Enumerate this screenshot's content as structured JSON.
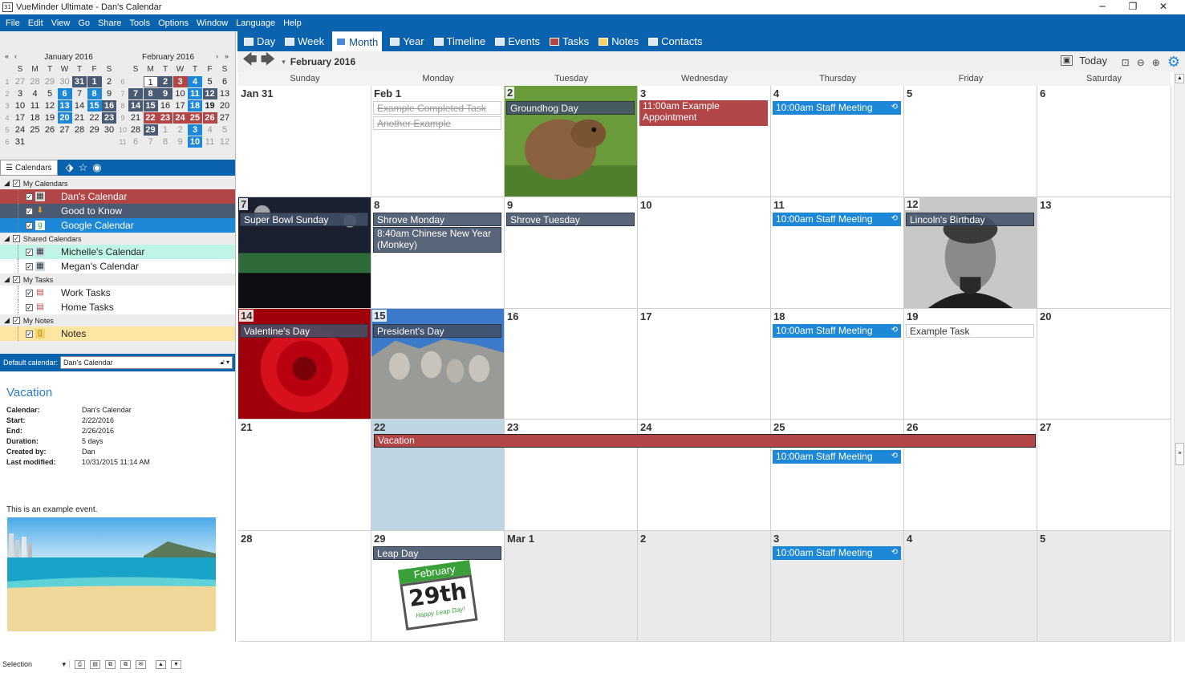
{
  "titlebar": {
    "app_icon": "31",
    "title": "VueMinder Ultimate - Dan's Calendar",
    "minimize": "─",
    "restore": "❐",
    "close": "✕"
  },
  "menu": [
    "File",
    "Edit",
    "View",
    "Go",
    "Share",
    "Tools",
    "Options",
    "Window",
    "Language",
    "Help"
  ],
  "minical": {
    "jan": {
      "title": "January 2016",
      "days": [
        "S",
        "M",
        "T",
        "W",
        "T",
        "F",
        "S"
      ],
      "weeks": [
        {
          "wk": "1",
          "cells": [
            {
              "t": "27",
              "c": "o"
            },
            {
              "t": "28",
              "c": "o"
            },
            {
              "t": "29",
              "c": "o"
            },
            {
              "t": "30",
              "c": "o"
            },
            {
              "t": "31",
              "c": "d"
            },
            {
              "t": "1",
              "c": "d"
            },
            {
              "t": "2",
              "c": ""
            }
          ]
        },
        {
          "wk": "2",
          "cells": [
            {
              "t": "3",
              "c": ""
            },
            {
              "t": "4",
              "c": ""
            },
            {
              "t": "5",
              "c": ""
            },
            {
              "t": "6",
              "c": "b"
            },
            {
              "t": "7",
              "c": ""
            },
            {
              "t": "8",
              "c": "b"
            },
            {
              "t": "9",
              "c": ""
            }
          ]
        },
        {
          "wk": "3",
          "cells": [
            {
              "t": "10",
              "c": ""
            },
            {
              "t": "11",
              "c": ""
            },
            {
              "t": "12",
              "c": ""
            },
            {
              "t": "13",
              "c": "b"
            },
            {
              "t": "14",
              "c": ""
            },
            {
              "t": "15",
              "c": "b"
            },
            {
              "t": "16",
              "c": "d"
            }
          ]
        },
        {
          "wk": "4",
          "cells": [
            {
              "t": "17",
              "c": ""
            },
            {
              "t": "18",
              "c": ""
            },
            {
              "t": "19",
              "c": ""
            },
            {
              "t": "20",
              "c": "b"
            },
            {
              "t": "21",
              "c": ""
            },
            {
              "t": "22",
              "c": ""
            },
            {
              "t": "23",
              "c": "d"
            }
          ]
        },
        {
          "wk": "5",
          "cells": [
            {
              "t": "24",
              "c": ""
            },
            {
              "t": "25",
              "c": ""
            },
            {
              "t": "26",
              "c": ""
            },
            {
              "t": "27",
              "c": ""
            },
            {
              "t": "28",
              "c": ""
            },
            {
              "t": "29",
              "c": ""
            },
            {
              "t": "30",
              "c": ""
            }
          ]
        },
        {
          "wk": "6",
          "cells": [
            {
              "t": "31",
              "c": ""
            },
            {
              "t": "",
              "c": ""
            },
            {
              "t": "",
              "c": ""
            },
            {
              "t": "",
              "c": ""
            },
            {
              "t": "",
              "c": ""
            },
            {
              "t": "",
              "c": ""
            },
            {
              "t": "",
              "c": ""
            }
          ]
        }
      ]
    },
    "feb": {
      "title": "February 2016",
      "days": [
        "S",
        "M",
        "T",
        "W",
        "T",
        "F",
        "S"
      ],
      "weeks": [
        {
          "wk": "6",
          "cells": [
            {
              "t": "",
              "c": ""
            },
            {
              "t": "1",
              "c": "w"
            },
            {
              "t": "2",
              "c": "d"
            },
            {
              "t": "3",
              "c": "r"
            },
            {
              "t": "4",
              "c": "b"
            },
            {
              "t": "5",
              "c": ""
            },
            {
              "t": "6",
              "c": ""
            }
          ]
        },
        {
          "wk": "7",
          "cells": [
            {
              "t": "7",
              "c": "d"
            },
            {
              "t": "8",
              "c": "d"
            },
            {
              "t": "9",
              "c": "d"
            },
            {
              "t": "10",
              "c": ""
            },
            {
              "t": "11",
              "c": "b"
            },
            {
              "t": "12",
              "c": "d"
            },
            {
              "t": "13",
              "c": ""
            }
          ]
        },
        {
          "wk": "8",
          "cells": [
            {
              "t": "14",
              "c": "d"
            },
            {
              "t": "15",
              "c": "d"
            },
            {
              "t": "16",
              "c": ""
            },
            {
              "t": "17",
              "c": ""
            },
            {
              "t": "18",
              "c": "b"
            },
            {
              "t": "19",
              "c": "bd"
            },
            {
              "t": "20",
              "c": ""
            }
          ]
        },
        {
          "wk": "9",
          "cells": [
            {
              "t": "21",
              "c": ""
            },
            {
              "t": "22",
              "c": "r"
            },
            {
              "t": "23",
              "c": "r"
            },
            {
              "t": "24",
              "c": "r"
            },
            {
              "t": "25",
              "c": "r"
            },
            {
              "t": "26",
              "c": "r"
            },
            {
              "t": "27",
              "c": ""
            }
          ]
        },
        {
          "wk": "10",
          "cells": [
            {
              "t": "28",
              "c": ""
            },
            {
              "t": "29",
              "c": "d"
            },
            {
              "t": "1",
              "c": "o"
            },
            {
              "t": "2",
              "c": "o"
            },
            {
              "t": "3",
              "c": "b"
            },
            {
              "t": "4",
              "c": "o"
            },
            {
              "t": "5",
              "c": "o"
            }
          ]
        },
        {
          "wk": "11",
          "cells": [
            {
              "t": "6",
              "c": "o"
            },
            {
              "t": "7",
              "c": "o"
            },
            {
              "t": "8",
              "c": "o"
            },
            {
              "t": "9",
              "c": "o"
            },
            {
              "t": "10",
              "c": "b"
            },
            {
              "t": "11",
              "c": "o"
            },
            {
              "t": "12",
              "c": "o"
            }
          ]
        }
      ]
    }
  },
  "cal_tabs": {
    "calendars": "Calendars"
  },
  "cal_list": {
    "my_calendars": "My Calendars",
    "dans": "Dan's Calendar",
    "good": "Good to Know",
    "google": "Google Calendar",
    "shared": "Shared Calendars",
    "michelle": "Michelle's Calendar",
    "megan": "Megan's Calendar",
    "my_tasks": "My Tasks",
    "work": "Work Tasks",
    "home": "Home Tasks",
    "my_notes": "My Notes",
    "notes": "Notes"
  },
  "default_calendar": {
    "label": "Default calendar:",
    "value": "Dan's Calendar"
  },
  "details": {
    "title": "Vacation",
    "calendar_label": "Calendar:",
    "calendar": "Dan's Calendar",
    "start_label": "Start:",
    "start": "2/22/2016",
    "end_label": "End:",
    "end": "2/26/2016",
    "duration_label": "Duration:",
    "duration": "5 days",
    "created_label": "Created by:",
    "created": "Dan",
    "modified_label": "Last modified:",
    "modified": "10/31/2015 11:14 AM",
    "description": "This is an example event."
  },
  "status": {
    "selection": "Selection"
  },
  "views": {
    "day": "Day",
    "week": "Week",
    "month": "Month",
    "year": "Year",
    "timeline": "Timeline",
    "events": "Events",
    "tasks": "Tasks",
    "notes": "Notes",
    "contacts": "Contacts"
  },
  "nav": {
    "title": "February 2016",
    "today": "Today"
  },
  "weekdays": [
    "Sunday",
    "Monday",
    "Tuesday",
    "Wednesday",
    "Thursday",
    "Friday",
    "Saturday"
  ],
  "days": [
    [
      "Jan 31",
      "Feb 1",
      "2",
      "3",
      "4",
      "5",
      "6"
    ],
    [
      "7",
      "8",
      "9",
      "10",
      "11",
      "12",
      "13"
    ],
    [
      "14",
      "15",
      "16",
      "17",
      "18",
      "19",
      "20"
    ],
    [
      "21",
      "22",
      "23",
      "24",
      "25",
      "26",
      "27"
    ],
    [
      "28",
      "29",
      "Mar 1",
      "2",
      "3",
      "4",
      "5"
    ]
  ],
  "events": {
    "task1": "Example Completed Task",
    "task2": "Another Example",
    "groundhog": "Groundhog Day",
    "appt": "11:00am Example Appointment",
    "staff": "10:00am Staff Meeting",
    "superbowl": "Super Bowl Sunday",
    "shrove_mon": "Shrove Monday",
    "chinese": "8:40am Chinese New Year (Monkey)",
    "shrove_tue": "Shrove Tuesday",
    "lincoln": "Lincoln's Birthday",
    "valentine": "Valentine's Day",
    "presidents": "President's Day",
    "example_task": "Example Task",
    "vacation": "Vacation",
    "leap": "Leap Day",
    "leap_badge_month": "February",
    "leap_badge_day": "29th",
    "leap_badge_text": "Happy Leap Day!"
  }
}
